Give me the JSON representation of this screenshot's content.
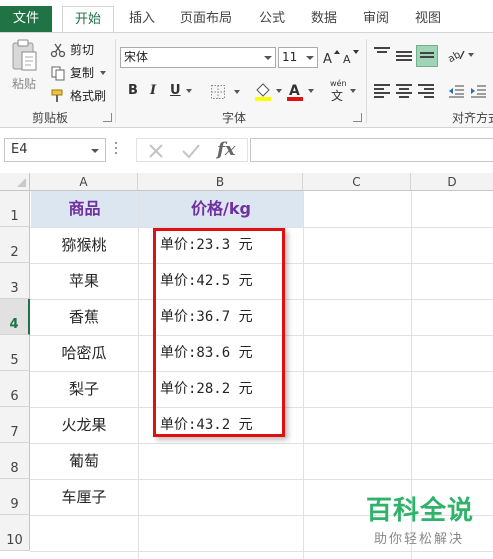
{
  "ribbon_tabs": [
    {
      "label": "文件"
    },
    {
      "label": "开始"
    },
    {
      "label": "插入"
    },
    {
      "label": "页面布局"
    },
    {
      "label": "公式"
    },
    {
      "label": "数据"
    },
    {
      "label": "审阅"
    },
    {
      "label": "视图"
    }
  ],
  "active_tab": "开始",
  "clipboard": {
    "paste_label": "粘贴",
    "cut_label": "剪切",
    "copy_label": "复制",
    "format_painter_label": "格式刷",
    "group_label": "剪贴板"
  },
  "font": {
    "font_name": "宋体",
    "font_size": "11",
    "bold": "B",
    "italic": "I",
    "underline": "U",
    "wen_label": "wén",
    "group_label": "字体"
  },
  "alignment": {
    "group_label": "对齐方式"
  },
  "formula_bar": {
    "name_box": "E4",
    "fx_label": "fx",
    "formula_value": ""
  },
  "columns": [
    {
      "label": "A"
    },
    {
      "label": "B"
    },
    {
      "label": "C"
    },
    {
      "label": "D"
    }
  ],
  "rows": [
    {
      "label": "1"
    },
    {
      "label": "2"
    },
    {
      "label": "3"
    },
    {
      "label": "4"
    },
    {
      "label": "5"
    },
    {
      "label": "6"
    },
    {
      "label": "7"
    },
    {
      "label": "8"
    },
    {
      "label": "9"
    },
    {
      "label": "10"
    }
  ],
  "selected_row": "4",
  "table": {
    "header": {
      "product": "商品",
      "price": "价格/kg"
    },
    "products": [
      "猕猴桃",
      "苹果",
      "香蕉",
      "哈密瓜",
      "梨子",
      "火龙果",
      "葡萄",
      "车厘子"
    ],
    "prices": [
      "单价:23.3 元",
      "单价:42.5 元",
      "单价:36.7 元",
      "单价:83.6 元",
      "单价:28.2 元",
      "单价:43.2 元"
    ]
  },
  "colors": {
    "excel_green": "#217346",
    "header_fill": "#dce6f1",
    "header_text": "#7030a0",
    "highlight_border": "#e01010",
    "watermark_green": "#2fb36b"
  },
  "watermark": {
    "title": "百科全说",
    "subtitle": "助你轻松解决"
  }
}
